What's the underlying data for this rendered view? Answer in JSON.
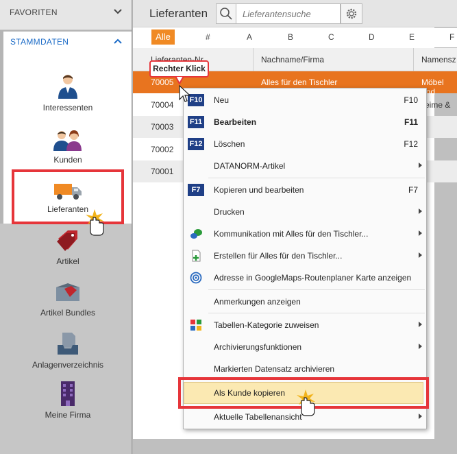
{
  "sidebar": {
    "favoriten_label": "FAVORITEN",
    "stammdaten_label": "STAMMDATEN",
    "items": [
      {
        "label": "Interessenten",
        "icon": "person-icon"
      },
      {
        "label": "Kunden",
        "icon": "people-icon"
      },
      {
        "label": "Lieferanten",
        "icon": "truck-icon"
      },
      {
        "label": "Artikel",
        "icon": "tag-icon"
      },
      {
        "label": "Artikel Bundles",
        "icon": "box-tag-icon"
      },
      {
        "label": "Anlagenverzeichnis",
        "icon": "inbox-file-icon"
      },
      {
        "label": "Meine Firma",
        "icon": "building-icon"
      }
    ]
  },
  "main": {
    "title": "Lieferanten",
    "search_placeholder": "Lieferantensuche",
    "alpha": {
      "alle": "Alle",
      "letters": [
        "#",
        "A",
        "B",
        "C",
        "D",
        "E"
      ]
    },
    "columns": [
      "Lieferanten-Nr.",
      "Nachname/Firma",
      "Namensz"
    ],
    "rows": [
      {
        "nr": "70005",
        "name": "Alles für den Tischler",
        "extra": "Möbel und"
      },
      {
        "nr": "70004",
        "name": "",
        "extra": "eime &"
      },
      {
        "nr": "70003",
        "name": "",
        "extra": ""
      },
      {
        "nr": "70002",
        "name": "",
        "extra": ""
      },
      {
        "nr": "70001",
        "name": "",
        "extra": ""
      }
    ]
  },
  "callout": "Rechter Klick",
  "context_menu": {
    "items": [
      {
        "key": "F10",
        "label": "Neu",
        "shortcut": "F10"
      },
      {
        "key": "F11",
        "label": "Bearbeiten",
        "shortcut": "F11"
      },
      {
        "key": "F12",
        "label": "Löschen",
        "shortcut": "F12"
      },
      {
        "label": "DATANORM-Artikel",
        "submenu": true
      },
      {
        "key": "F7",
        "label": "Kopieren und bearbeiten",
        "shortcut": "F7"
      },
      {
        "label": "Drucken",
        "submenu": true
      },
      {
        "label": "Kommunikation mit Alles für den Tischler...",
        "submenu": true
      },
      {
        "label": "Erstellen für Alles für den Tischler...",
        "submenu": true
      },
      {
        "label": "Adresse in GoogleMaps-Routenplaner Karte anzeigen"
      },
      {
        "label": "Anmerkungen anzeigen"
      },
      {
        "label": "Tabellen-Kategorie zuweisen",
        "submenu": true
      },
      {
        "label": "Archivierungsfunktionen",
        "submenu": true
      },
      {
        "label": "Markierten Datensatz archivieren"
      },
      {
        "label": "Als Kunde kopieren"
      },
      {
        "label": "Aktuelle Tabellenansicht",
        "submenu": true
      }
    ]
  },
  "colors": {
    "accent_orange": "#e8741f",
    "highlight_red": "#e6353a",
    "fkey_blue": "#1f3f86",
    "link_blue": "#1d6cc7"
  }
}
